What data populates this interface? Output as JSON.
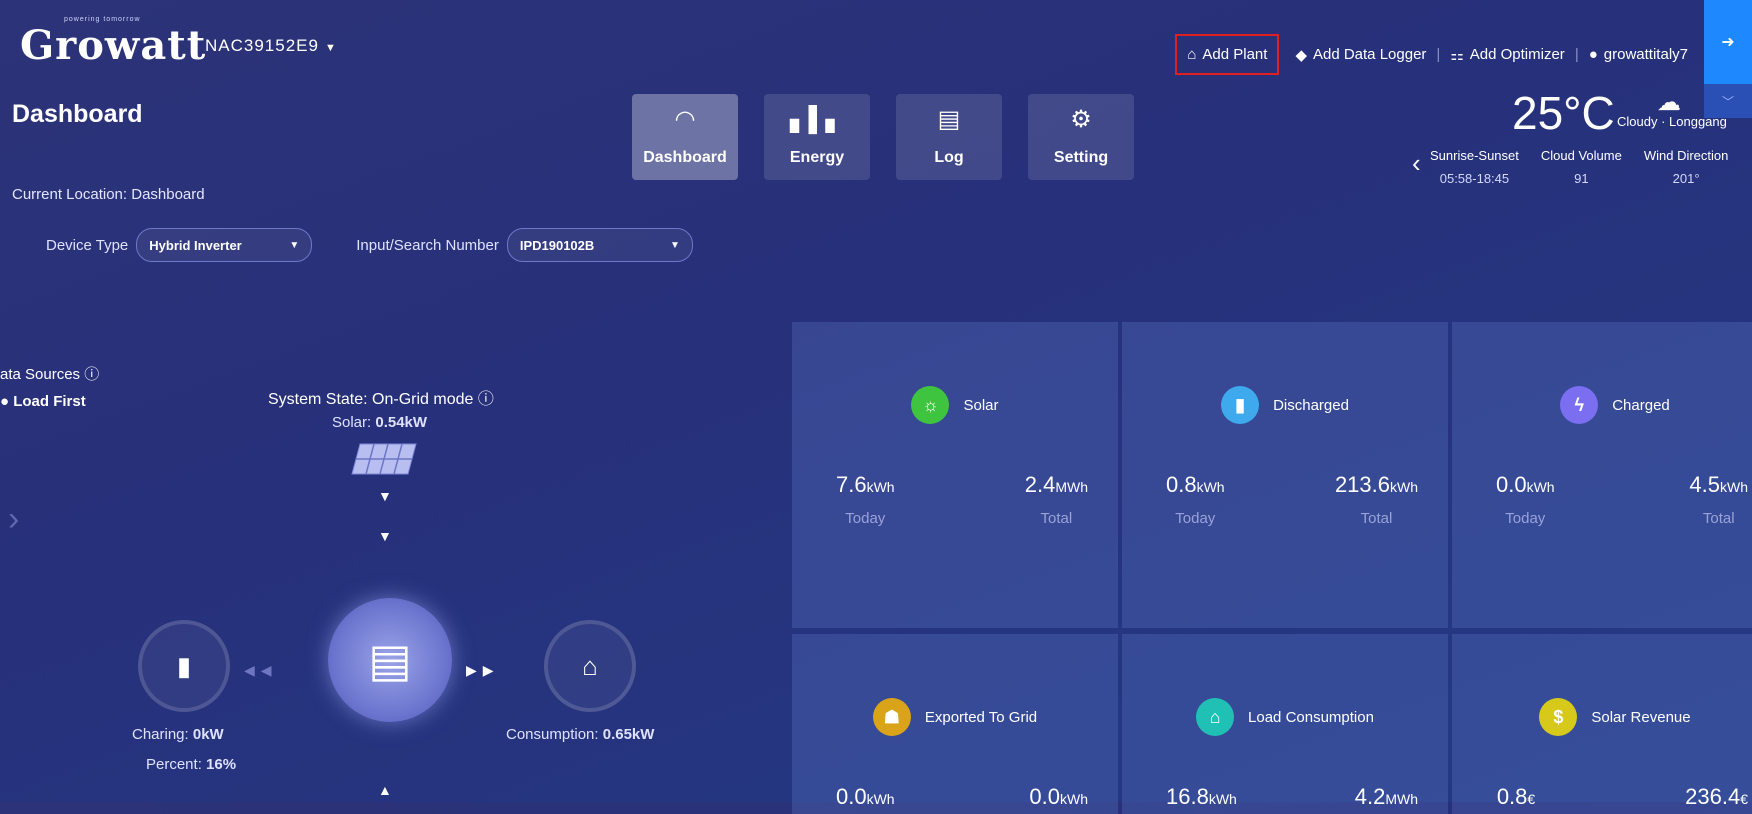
{
  "brand": {
    "logo": "Growatt",
    "tagline": "powering tomorrow"
  },
  "header": {
    "plant_id": "NAC39152E9",
    "links": {
      "add_plant": "Add Plant",
      "add_data_logger": "Add Data Logger",
      "add_optimizer": "Add Optimizer",
      "user": "growattitaly7"
    }
  },
  "page": {
    "title": "Dashboard",
    "current_location": "Current Location: Dashboard"
  },
  "nav": {
    "tabs": [
      {
        "label": "Dashboard",
        "icon": "gauge-icon",
        "active": true
      },
      {
        "label": "Energy",
        "icon": "bar-chart-icon",
        "active": false
      },
      {
        "label": "Log",
        "icon": "log-icon",
        "active": false
      },
      {
        "label": "Setting",
        "icon": "gear-icon",
        "active": false
      }
    ]
  },
  "weather": {
    "temperature": "25°C",
    "description": "Cloudy · Longgang",
    "columns": [
      {
        "label": "Sunrise-Sunset",
        "value": "05:58-18:45"
      },
      {
        "label": "Cloud Volume",
        "value": "91"
      },
      {
        "label": "Wind Direction",
        "value": "201°"
      }
    ]
  },
  "filters": {
    "device_type_label": "Device Type",
    "device_type_value": "Hybrid Inverter",
    "search_label": "Input/Search Number",
    "search_value": "IPD190102B"
  },
  "flow": {
    "data_sources": "ata Sources",
    "load_first": "Load First",
    "system_state": "System State:  On-Grid mode",
    "solar_label": "Solar:",
    "solar_value": "0.54kW",
    "charging_label": "Charing:",
    "charging_value": "0kW",
    "percent_label": "Percent:",
    "percent_value": "16%",
    "consumption_label": "Consumption:",
    "consumption_value": "0.65kW"
  },
  "stats": [
    {
      "title": "Solar",
      "icon": "sun-icon",
      "color": "#3ec43e",
      "today_value": "7.6",
      "today_unit": "kWh",
      "total_value": "2.4",
      "total_unit": "MWh"
    },
    {
      "title": "Discharged",
      "icon": "battery-icon",
      "color": "#3fa9ee",
      "today_value": "0.8",
      "today_unit": "kWh",
      "total_value": "213.6",
      "total_unit": "kWh"
    },
    {
      "title": "Charged",
      "icon": "charge-icon",
      "color": "#7b6ef0",
      "today_value": "0.0",
      "today_unit": "kWh",
      "total_value": "4.5",
      "total_unit": "kWh"
    },
    {
      "title": "Exported To Grid",
      "icon": "pylon-icon",
      "color": "#d9a31a",
      "today_value": "0.0",
      "today_unit": "kWh",
      "total_value": "0.0",
      "total_unit": "kWh"
    },
    {
      "title": "Load Consumption",
      "icon": "home-icon",
      "color": "#20c1b4",
      "today_value": "16.8",
      "today_unit": "kWh",
      "total_value": "4.2",
      "total_unit": "MWh"
    },
    {
      "title": "Solar Revenue",
      "icon": "coin-icon",
      "color": "#d6c91a",
      "today_value": "0.8",
      "today_unit": "€",
      "total_value": "236.4",
      "total_unit": "€"
    }
  ],
  "labels": {
    "today": "Today",
    "total": "Total"
  }
}
